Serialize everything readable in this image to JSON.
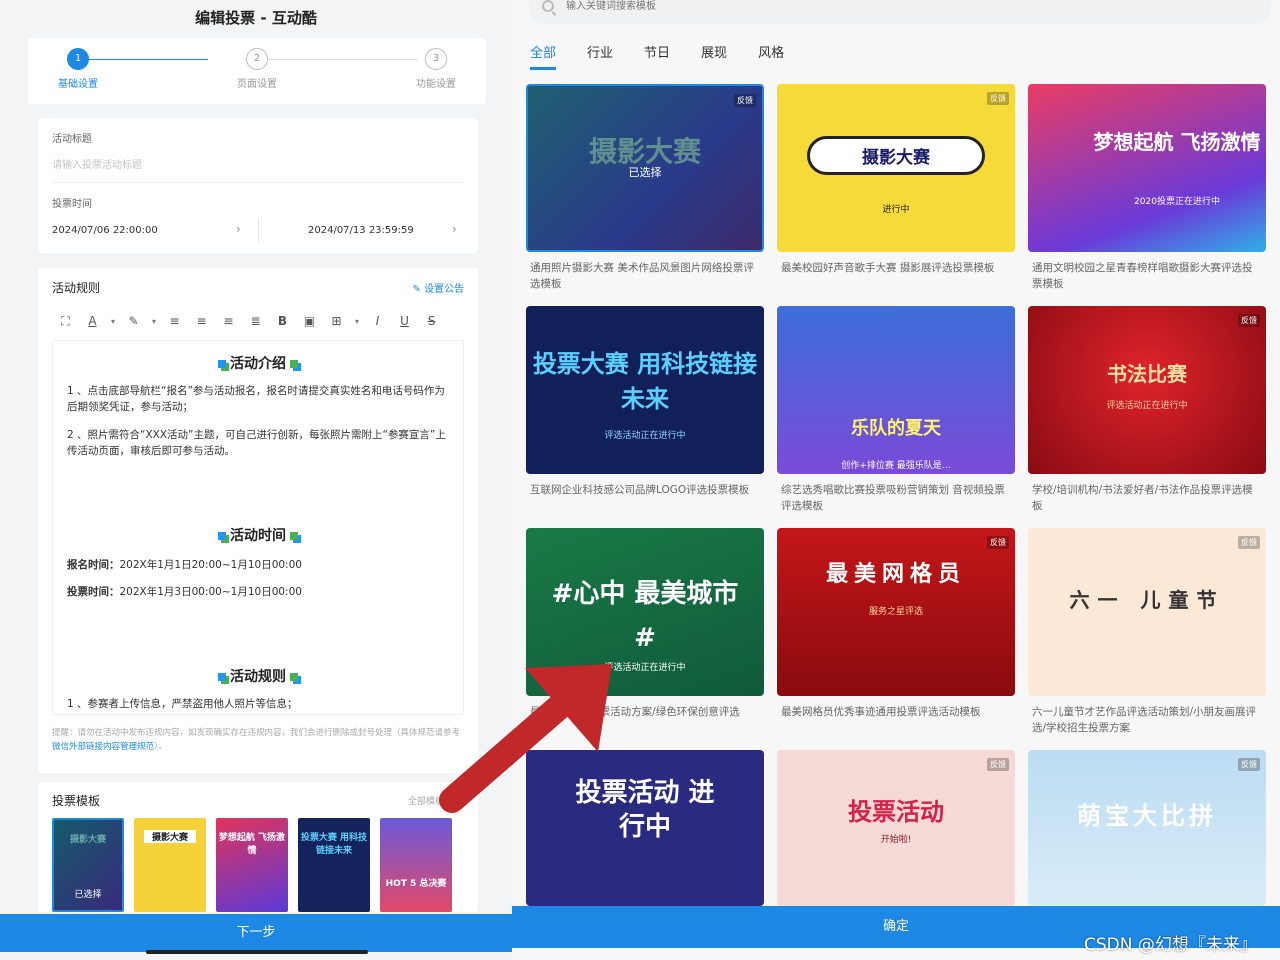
{
  "left": {
    "title": "编辑投票 - 互动酷",
    "steps": [
      {
        "num": "1",
        "label": "基础设置"
      },
      {
        "num": "2",
        "label": "页面设置"
      },
      {
        "num": "3",
        "label": "功能设置"
      }
    ],
    "basic": {
      "title_label": "活动标题",
      "title_placeholder": "请输入投票活动标题",
      "time_label": "投票时间",
      "start": "2024/07/06 22:00:00",
      "end": "2024/07/13 23:59:59"
    },
    "rules": {
      "title": "活动规则",
      "notice_link": "设置公告",
      "sections": {
        "intro_heading": "活动介绍",
        "intro_p1": "1 、点击底部导航栏“报名”参与活动报名，报名时请提交真实姓名和电话号码作为后期领奖凭证，参与活动；",
        "intro_p2": "2 、照片需符合“XXX活动”主题，可自己进行创新，每张照片需附上“参赛宣言”上传活动页面，审核后即可参与活动。",
        "time_heading": "活动时间",
        "signup_label": "报名时间：",
        "signup_value": "202X年1月1日20:00~1月10日00:00",
        "vote_label": "投票时间：",
        "vote_value": "202X年1月3日00:00~1月10日00:00",
        "rule_heading": "活动规则",
        "rule_p1": "1 、参赛者上传信息，严禁盗用他人照片等信息；"
      },
      "tip": "提醒：请勿在活动中发布违规内容，如发现确实存在违规内容，我们会进行删除或封号处理（具体规范请参考",
      "tip_link": "微信外部链接内容管理规范",
      "tip_end": "）。"
    },
    "templates": {
      "title": "投票模板",
      "all": "全部模板",
      "items": [
        {
          "text": "摄影大赛",
          "selected": "已选择",
          "color": "#155a6b"
        },
        {
          "text": "摄影大赛",
          "color": "#f6d23a"
        },
        {
          "text": "梦想起航 飞扬激情",
          "color": "#e0345a"
        },
        {
          "text": "投票大赛 用科技链接未来",
          "color": "#14235c"
        },
        {
          "text": "HOT 5 总决赛",
          "color": "#6a5ad8"
        }
      ]
    },
    "next_button": "下一步"
  },
  "right": {
    "search_placeholder": "输入关键词搜索模板",
    "tabs": [
      "全部",
      "行业",
      "节日",
      "展现",
      "风格"
    ],
    "cards": [
      {
        "title": "摄影大赛",
        "sub": "已选择",
        "badge": "反馈",
        "desc": "通用照片摄影大赛 美术作品风景图片网络投票评选模板",
        "bg": "#1f6070"
      },
      {
        "title": "摄影大赛",
        "sub": "进行中",
        "badge": "反馈",
        "desc": "最美校园好声音歌手大赛 摄影展评选投票模板",
        "bg": "#f6da3a"
      },
      {
        "title": "梦想起航 飞扬激情",
        "sub": "2020投票正在进行中",
        "badge": "",
        "desc": "通用文明校园之星青春榜样唱歌摄影大赛评选投票模板",
        "bg": "#ea3d63"
      },
      {
        "title": "投票大赛 用科技链接未来",
        "sub": "评选活动正在进行中",
        "badge": "",
        "desc": "互联网企业科技感公司品牌LOGO评选投票模板",
        "bg": "#12205a"
      },
      {
        "title": "乐队的夏天",
        "sub": "创作+排位赛 最强乐队是…",
        "badge": "",
        "desc": "综艺选秀唱歌比赛投票吸粉营销策划 音视频投票评选模板",
        "bg": "#3d6ed8"
      },
      {
        "title": "书法比赛",
        "sub": "评选活动正在进行中",
        "badge": "反馈",
        "desc": "学校/培训机构/书法爱好者/书法作品投票评选模板",
        "bg": "#c4131c"
      },
      {
        "title": "#心中 最美城市#",
        "sub": "评选活动正在进行中",
        "badge": "",
        "desc": "最美城市 模板 票活动方案/绿色环保创意评选",
        "bg": "#1a7a47"
      },
      {
        "title": "最美网格员",
        "sub": "服务之星评选",
        "badge": "反馈",
        "desc": "最美网格员优秀事迹通用投票评选活动模板",
        "bg": "#c41619"
      },
      {
        "title": "六一 儿童节",
        "sub": "",
        "badge": "反馈",
        "desc": "六一儿童节才艺作品评选活动策划/小朋友画展评选/学校招生投票方案",
        "bg": "#fbe8d6"
      },
      {
        "title": "投票活动 进行中",
        "sub": "",
        "badge": "",
        "desc": "",
        "bg": "#2a2a80"
      },
      {
        "title": "投票活动",
        "sub": "开始啦!",
        "badge": "反馈",
        "desc": "",
        "bg": "#f5d9d6"
      },
      {
        "title": "萌宝大比拼",
        "sub": "",
        "badge": "反馈",
        "desc": "",
        "bg": "#bcdcf3"
      }
    ],
    "confirm_button": "确定"
  },
  "watermark": "CSDN @幻想『未来』",
  "colors": {
    "accent": "#1e88e5",
    "arrow": "#c0282a"
  }
}
